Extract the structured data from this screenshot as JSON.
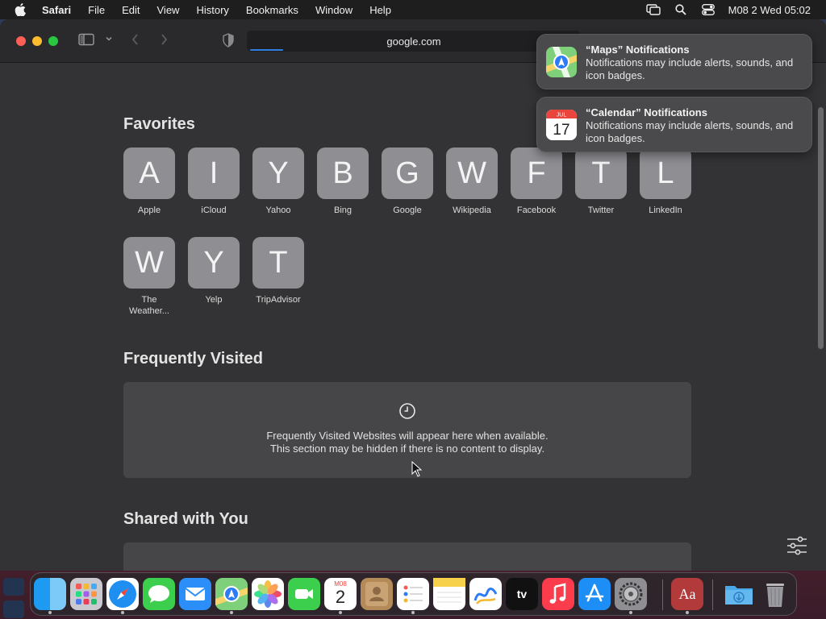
{
  "menubar": {
    "app_name": "Safari",
    "items": [
      "File",
      "Edit",
      "View",
      "History",
      "Bookmarks",
      "Window",
      "Help"
    ],
    "clock": "M08 2 Wed  05:02"
  },
  "toolbar": {
    "url": "google.com",
    "load_progress": 0.1
  },
  "favorites": {
    "title": "Favorites",
    "items": [
      {
        "letter": "A",
        "label": "Apple"
      },
      {
        "letter": "I",
        "label": "iCloud"
      },
      {
        "letter": "Y",
        "label": "Yahoo"
      },
      {
        "letter": "B",
        "label": "Bing"
      },
      {
        "letter": "G",
        "label": "Google"
      },
      {
        "letter": "W",
        "label": "Wikipedia"
      },
      {
        "letter": "F",
        "label": "Facebook"
      },
      {
        "letter": "T",
        "label": "Twitter"
      },
      {
        "letter": "L",
        "label": "LinkedIn"
      },
      {
        "letter": "W",
        "label": "The Weather..."
      },
      {
        "letter": "Y",
        "label": "Yelp"
      },
      {
        "letter": "T",
        "label": "TripAdvisor"
      }
    ]
  },
  "frequently_visited": {
    "title": "Frequently Visited",
    "line1": "Frequently Visited Websites will appear here when available.",
    "line2": "This section may be hidden if there is no content to display."
  },
  "shared_with_you": {
    "title": "Shared with You"
  },
  "notifications": [
    {
      "title": "“Maps” Notifications",
      "body": "Notifications may include alerts, sounds, and icon badges."
    },
    {
      "title": "“Calendar” Notifications",
      "body": "Notifications may include alerts, sounds, and icon badges."
    }
  ],
  "calendar_icon": {
    "month": "JUL",
    "day": "17"
  },
  "dock": {
    "calendar_month": "M08",
    "calendar_day": "2",
    "tv_label": "tv",
    "dictionary_label": "Aa",
    "apps": [
      "finder",
      "launchpad",
      "safari",
      "messages",
      "mail",
      "maps",
      "photos",
      "facetime",
      "calendar",
      "contacts",
      "reminders",
      "notes",
      "freeform",
      "tv",
      "music",
      "app-store",
      "system-settings",
      "dictionary",
      "downloads",
      "trash"
    ]
  }
}
